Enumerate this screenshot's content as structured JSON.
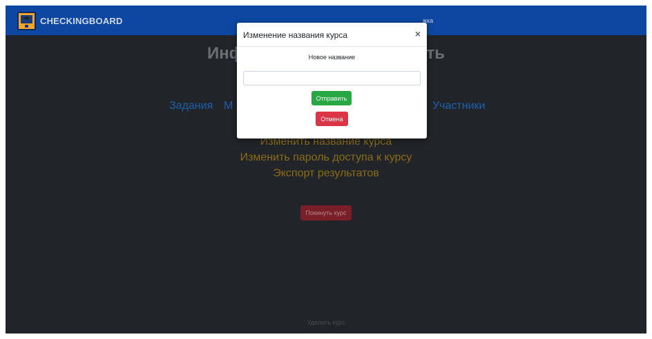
{
  "navbar": {
    "brand": "CHECKINGBOARD",
    "support_partial": "жка",
    "color": "#0d47a1"
  },
  "page": {
    "title_left": "Инф",
    "title_right": "ость",
    "tabs": {
      "tasks": "Задания",
      "m_partial": "М",
      "participants": "Участники"
    },
    "settings_links": [
      "Изменить название курса",
      "Изменить пароль доступа к курсу",
      "Экспорт результатов"
    ],
    "leave_course": "Покинуть курс",
    "delete_course": "Удалить курс"
  },
  "modal": {
    "title": "Изменение названия курса",
    "close_glyph": "×",
    "field_label": "Новое название",
    "input_value": "",
    "submit_label": "Отправить",
    "cancel_label": "Отмена"
  },
  "colors": {
    "background": "#212529",
    "submit": "#28a745",
    "cancel": "#dc3545",
    "link": "#8a6b18"
  }
}
